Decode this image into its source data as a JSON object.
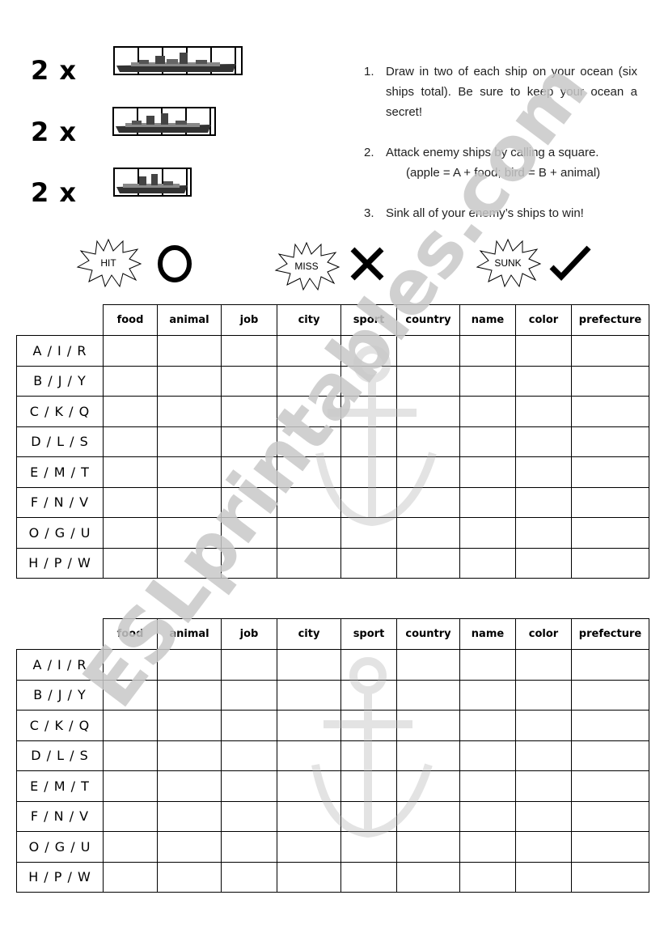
{
  "ships": [
    {
      "count_label": "2 x",
      "length": 5
    },
    {
      "count_label": "2 x",
      "length": 4
    },
    {
      "count_label": "2 x",
      "length": 3
    }
  ],
  "instructions": [
    {
      "number": "1.",
      "text": "Draw in two of each ship on your ocean (six ships total). Be sure to keep your ocean a secret!"
    },
    {
      "number": "2.",
      "text": "Attack enemy ships by calling a square.",
      "example": "(apple = A + food; bird = B + animal)"
    },
    {
      "number": "3.",
      "text": "Sink all of your enemy’s ships to win!"
    }
  ],
  "legend": [
    {
      "label": "HIT",
      "symbol": "circle-icon"
    },
    {
      "label": "MISS",
      "symbol": "cross-icon"
    },
    {
      "label": "SUNK",
      "symbol": "checkmark-icon"
    }
  ],
  "grid": {
    "columns": [
      "food",
      "animal",
      "job",
      "city",
      "sport",
      "country",
      "name",
      "color",
      "prefecture"
    ],
    "rows": [
      "A / I / R",
      "B / J / Y",
      "C / K / Q",
      "D / L / S",
      "E / M / T",
      "F / N / V",
      "O / G / U",
      "H / P / W"
    ]
  },
  "tables": [
    {
      "name": "my-ocean"
    },
    {
      "name": "enemy-ocean"
    }
  ],
  "watermark": {
    "text": "ESLprintables.com",
    "color": "#c8c8c8"
  }
}
